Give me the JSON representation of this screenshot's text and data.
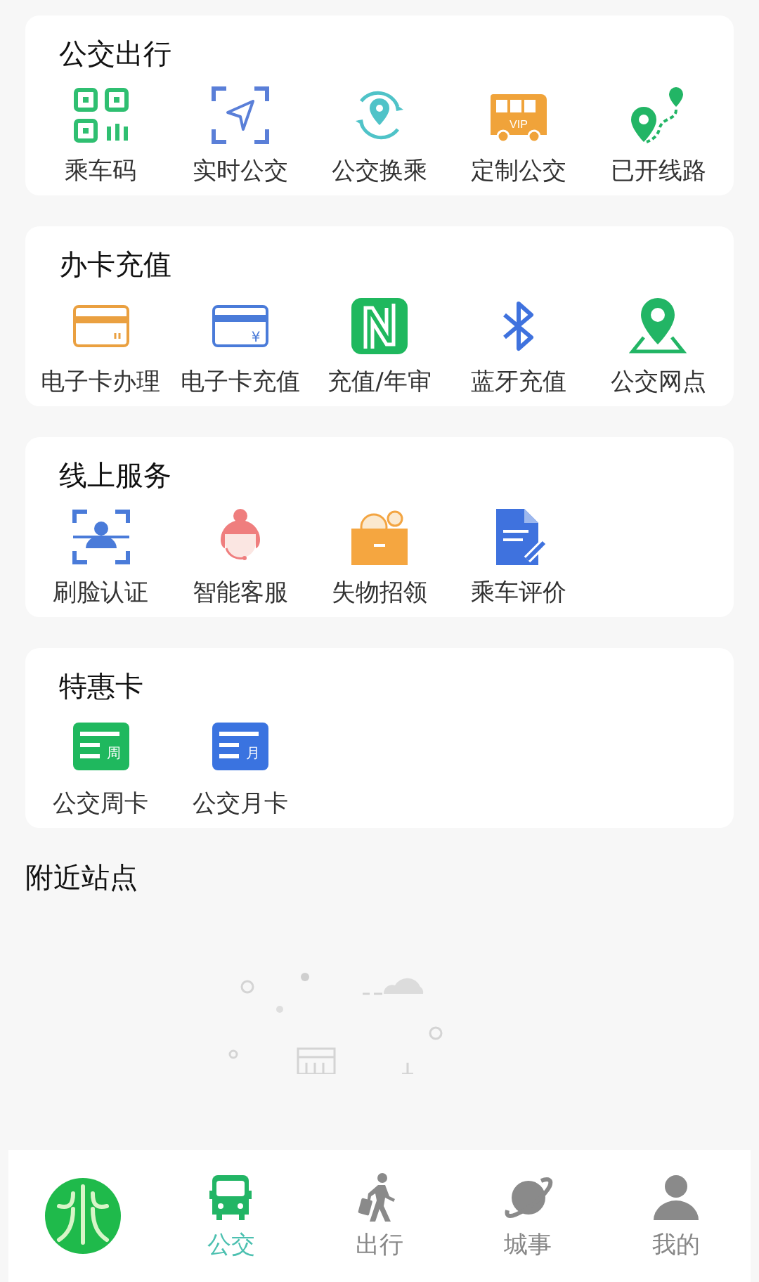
{
  "sections": [
    {
      "title": "公交出行",
      "items": [
        {
          "label": "乘车码",
          "kind": "qr"
        },
        {
          "label": "实时公交",
          "kind": "navigate"
        },
        {
          "label": "公交换乘",
          "kind": "transfer"
        },
        {
          "label": "定制公交",
          "kind": "vipbus",
          "badge": "VIP"
        },
        {
          "label": "已开线路",
          "kind": "route"
        }
      ]
    },
    {
      "title": "办卡充值",
      "items": [
        {
          "label": "电子卡办理",
          "kind": "card"
        },
        {
          "label": "电子卡充值",
          "kind": "paycard",
          "badge": "¥"
        },
        {
          "label": "充值/年审",
          "kind": "nfc"
        },
        {
          "label": "蓝牙充值",
          "kind": "bluetooth"
        },
        {
          "label": "公交网点",
          "kind": "pin"
        }
      ]
    },
    {
      "title": "线上服务",
      "items": [
        {
          "label": "刷脸认证",
          "kind": "face"
        },
        {
          "label": "智能客服",
          "kind": "agent"
        },
        {
          "label": "失物招领",
          "kind": "box"
        },
        {
          "label": "乘车评价",
          "kind": "doc"
        }
      ]
    },
    {
      "title": "特惠卡",
      "items": [
        {
          "label": "公交周卡",
          "kind": "ticket",
          "color": "#1fb85e",
          "badge": "周"
        },
        {
          "label": "公交月卡",
          "kind": "ticket",
          "color": "#3a73e0",
          "badge": "月"
        }
      ]
    }
  ],
  "nearby": {
    "title": "附近站点"
  },
  "nav": [
    {
      "label": "公交",
      "kind": "bus",
      "selected": true
    },
    {
      "label": "出行",
      "kind": "walker",
      "selected": false
    },
    {
      "label": "城事",
      "kind": "planet",
      "selected": false
    },
    {
      "label": "我的",
      "kind": "user",
      "selected": false
    }
  ]
}
